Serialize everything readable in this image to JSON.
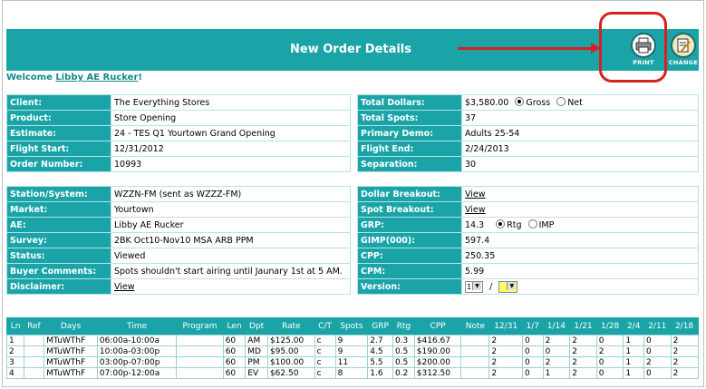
{
  "header": {
    "title": "New Order Details",
    "print_label": "PRINT",
    "change_label": "CHANGE"
  },
  "welcome": {
    "prefix": "Welcome",
    "user": "Libby AE Rucker",
    "suffix": "!"
  },
  "info_left": [
    {
      "label": "Client:",
      "value": "The Everything Stores"
    },
    {
      "label": "Product:",
      "value": "Store Opening"
    },
    {
      "label": "Estimate:",
      "value": "24 -  TES Q1 Yourtown Grand Opening"
    },
    {
      "label": "Flight Start:",
      "value": "12/31/2012"
    },
    {
      "label": "Order Number:",
      "value": "10993"
    }
  ],
  "info_right": {
    "total_dollars": {
      "label": "Total Dollars:",
      "value": "$3,580.00",
      "opt1": "Gross",
      "opt2": "Net"
    },
    "total_spots": {
      "label": "Total Spots:",
      "value": "37"
    },
    "primary_demo": {
      "label": "Primary Demo:",
      "value": "Adults 25-54"
    },
    "flight_end": {
      "label": "Flight End:",
      "value": "2/24/2013"
    },
    "separation": {
      "label": "Separation:",
      "value": "30"
    }
  },
  "station_left": [
    {
      "label": "Station/System:",
      "value": "WZZN-FM (sent as WZZZ-FM)"
    },
    {
      "label": "Market:",
      "value": "Yourtown"
    },
    {
      "label": "AE:",
      "value": "Libby AE Rucker"
    },
    {
      "label": "Survey:",
      "value": "2BK Oct10-Nov10 MSA ARB PPM"
    },
    {
      "label": "Status:",
      "value": "Viewed"
    },
    {
      "label": "Buyer Comments:",
      "value": "Spots shouldn't start airing until Jaunary 1st at 5 AM."
    },
    {
      "label": "Disclaimer:",
      "value": "View"
    }
  ],
  "station_right": {
    "dollar_breakout": {
      "label": "Dollar Breakout:",
      "value": "View"
    },
    "spot_breakout": {
      "label": "Spot Breakout:",
      "value": "View"
    },
    "grp": {
      "label": "GRP:",
      "value": "14.3",
      "opt1": "Rtg",
      "opt2": "IMP"
    },
    "gimp": {
      "label": "GIMP(000):",
      "value": "597.4"
    },
    "cpp": {
      "label": "CPP:",
      "value": "250.35"
    },
    "cpm": {
      "label": "CPM:",
      "value": "5.99"
    },
    "version": {
      "label": "Version:",
      "value": "1",
      "sep": "/",
      "value2": ""
    }
  },
  "grid": {
    "headers": [
      "Ln",
      "Ref",
      "Days",
      "Time",
      "Program",
      "Len",
      "Dpt",
      "Rate",
      "C/T",
      "Spots",
      "GRP",
      "Rtg",
      "CPP",
      "Note",
      "12/31",
      "1/7",
      "1/14",
      "1/21",
      "1/28",
      "2/4",
      "2/11",
      "2/18"
    ],
    "rows": [
      [
        "1",
        "",
        "MTuWThF",
        "06:00a-10:00a",
        "",
        "60",
        "AM",
        "$125.00",
        "c",
        "9",
        "2.7",
        "0.3",
        "$416.67",
        "",
        "2",
        "0",
        "2",
        "2",
        "0",
        "1",
        "0",
        "2"
      ],
      [
        "2",
        "",
        "MTuWThF",
        "10:00a-03:00p",
        "",
        "60",
        "MD",
        "$95.00",
        "c",
        "9",
        "4.5",
        "0.5",
        "$190.00",
        "",
        "2",
        "0",
        "0",
        "2",
        "2",
        "1",
        "0",
        "2"
      ],
      [
        "3",
        "",
        "MTuWThF",
        "03:00p-07:00p",
        "",
        "60",
        "PM",
        "$100.00",
        "c",
        "11",
        "5.5",
        "0.5",
        "$200.00",
        "",
        "2",
        "0",
        "2",
        "2",
        "0",
        "1",
        "2",
        "2"
      ],
      [
        "4",
        "",
        "MTuWThF",
        "07:00p-12:00a",
        "",
        "60",
        "EV",
        "$62.50",
        "c",
        "8",
        "1.6",
        "0.2",
        "$312.50",
        "",
        "2",
        "0",
        "1",
        "2",
        "0",
        "1",
        "0",
        "2"
      ]
    ]
  },
  "colors": {
    "teal": "#1aa4a8",
    "highlight": "#d82020"
  }
}
